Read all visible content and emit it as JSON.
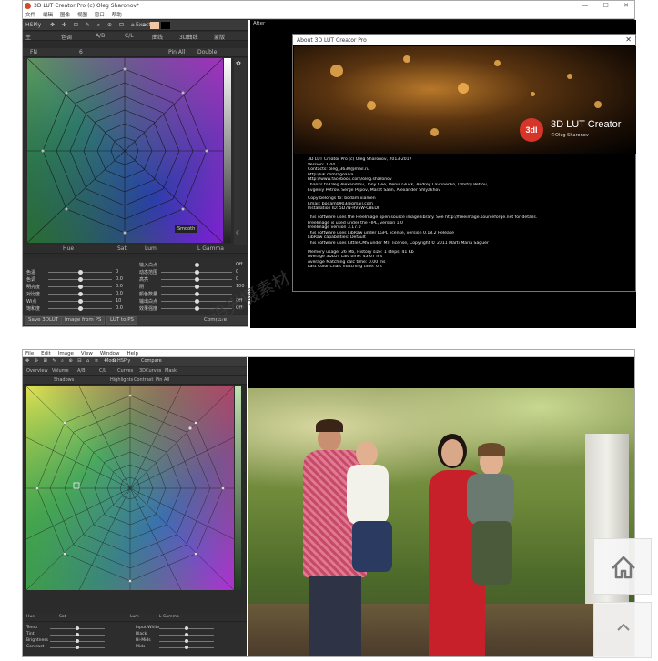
{
  "shot1": {
    "window_title": "3D LUT Creator Pro (c) Oleg Sharonov*",
    "window_buttons": [
      "—",
      "☐",
      "✕"
    ],
    "menu": [
      "文件",
      "编辑",
      "图像",
      "视图",
      "窗口",
      "帮助"
    ],
    "toolbar_left": "HSPly",
    "toolbar_exact": "Exact",
    "after_label": "After",
    "tabs": [
      "主",
      "色调",
      "A/B",
      "C/L",
      "曲线",
      "3D曲线",
      "蒙版"
    ],
    "wheel_header": {
      "fn": "FN",
      "value": "6",
      "pin": "Pin All",
      "double": "Double"
    },
    "smooth_label": "Smooth",
    "hue_row": [
      "Hue",
      "Sat",
      "Lum",
      "L Gamma"
    ],
    "left_sliders": [
      {
        "label": "色温",
        "value": "0"
      },
      {
        "label": "色调",
        "value": "0.0"
      },
      {
        "label": "明亮度",
        "value": "0.0"
      },
      {
        "label": "对比度",
        "value": "0.0"
      },
      {
        "label": "Wi点",
        "value": "10"
      },
      {
        "label": "饱和度",
        "value": "0.0"
      }
    ],
    "right_sliders": [
      {
        "label": "输入白点",
        "value": "Off"
      },
      {
        "label": "动态范围",
        "value": "0"
      },
      {
        "label": "高亮",
        "value": "0"
      },
      {
        "label": "阴",
        "value": "100"
      },
      {
        "label": "颜色数量",
        "value": ""
      },
      {
        "label": "输出白点",
        "value": "Off"
      },
      {
        "label": "效果强度",
        "value": "Off"
      }
    ],
    "bottom_buttons": [
      "Save 3DLUT",
      "Image from PS",
      "LUT to PS"
    ],
    "compare_label": "Compare",
    "about": {
      "title": "About 3D LUT Creator Pro",
      "close": "✕",
      "logo_mark": "3dl",
      "logo_text": "3D LUT Creator",
      "logo_sub": "©Oleg Sharonov",
      "lines": [
        "3D LUT Creator Pro (c) Oleg Sharonov, 2013-2017",
        "Version: 1.44",
        "Contacts: oleg_3630@mail.ru",
        "http://vk.com/agoalva",
        "http://www.facebook.com/oleg.sharonov",
        "Thanks to Oleg Alexandrov, Tony Gee, Denis Gluck, Andrey Lavrinenko, Dmitry Petrov,",
        "    Evgeniy Petrov, Serge Popov, Marat Salin, Alexander Shlyakhov",
        "",
        "Copy belongs to: bodam xiamen",
        "Email: bodam0903@gmail.com",
        "Installation ID: 5D7N-RV5W-C8EDI",
        "",
        "This software uses the FreeImage open source image library. See http://freeimage.sourceforge.net for details.",
        "FreeImage is used under the FIPL, version 1.0",
        "FreeImage version 3.17.0",
        "This software uses LibRaw under LGPL license, version 0.18.2 Release",
        "LibRaw capabilities: Default",
        "This software uses Little CMS under MIT license, Copyright © 2011 Marti Maria Saguer",
        "",
        "Memory usage: 26 Mb, History size: 1 steps, 41 Kb",
        "Average 3DLUT calc time: 43.67 ms",
        "Average Matching calc time: 0.00 ms",
        "Last Color Chart matching time: 0 s"
      ]
    }
  },
  "watermark": "追光摄素材",
  "shot2": {
    "menu": [
      "File",
      "Edit",
      "Image",
      "View",
      "Window",
      "Help"
    ],
    "toolbar_mode": "Mode",
    "toolbar_mode_value": "HSPly",
    "compare": "Compare",
    "tabs": [
      "Overview",
      "Volume",
      "A/B",
      "C/L",
      "Curves",
      "3DCurves",
      "Mask"
    ],
    "sub_tabs": [
      "Shadows",
      "Highlights",
      "Contrast",
      "Pin All"
    ],
    "status_row": [
      "Hue",
      "Sat",
      "Lum",
      "L Gamma"
    ],
    "left_sliders": [
      "Temp",
      "Tint",
      "Brightness",
      "Contrast"
    ],
    "right_sliders": [
      "Input White",
      "Black",
      "Hi-Mids",
      "Mids"
    ]
  },
  "side_buttons": {
    "home_icon": "house-icon",
    "top_icon": "chevron-up-icon"
  }
}
